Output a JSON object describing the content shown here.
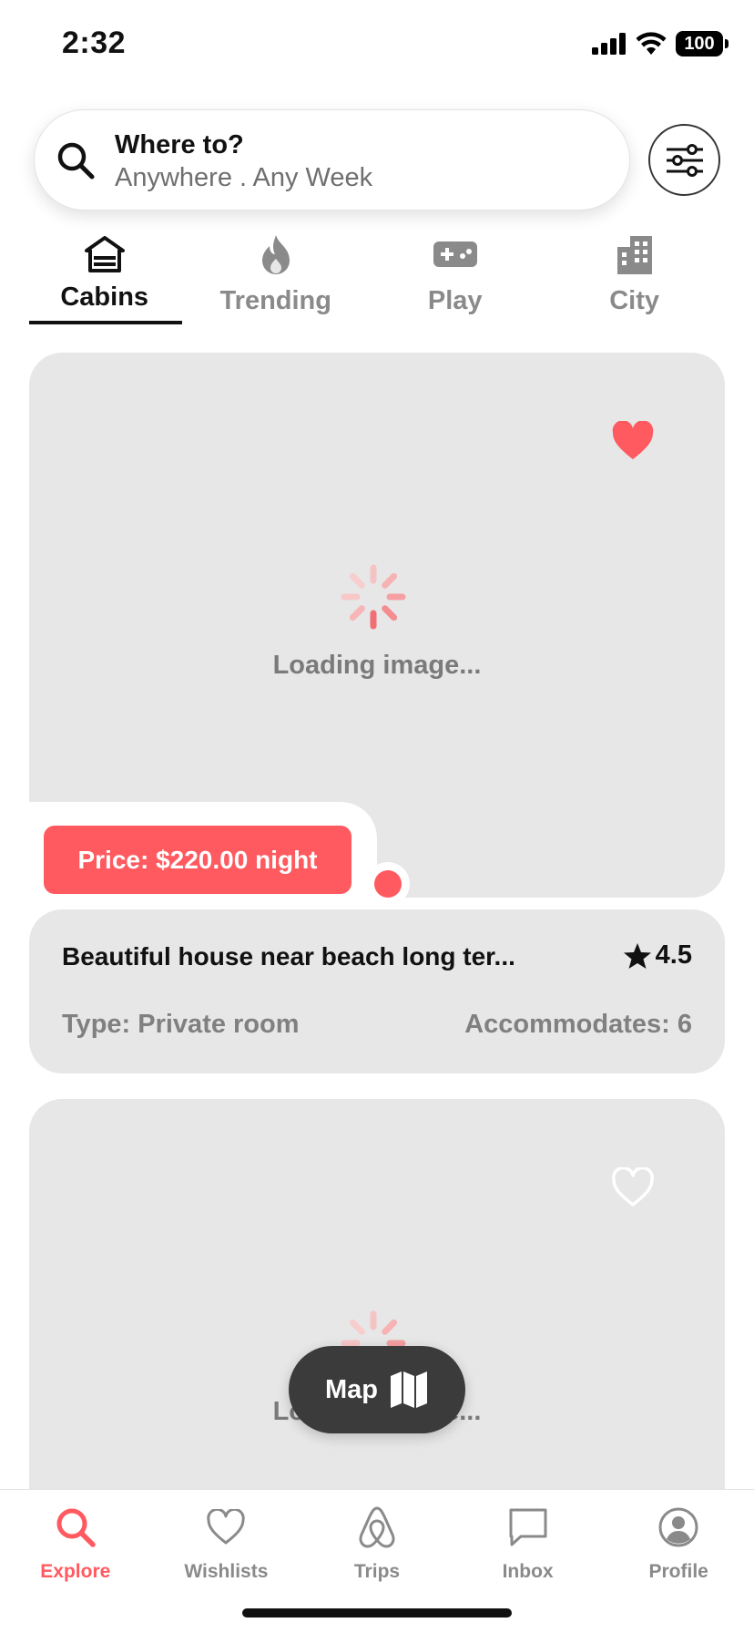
{
  "status_bar": {
    "time": "2:32",
    "battery": "100"
  },
  "search": {
    "title": "Where to?",
    "subtitle": "Anywhere . Any Week"
  },
  "tabs": [
    {
      "label": "Cabins",
      "icon": "cabin-icon",
      "active": true
    },
    {
      "label": "Trending",
      "icon": "fire-icon",
      "active": false
    },
    {
      "label": "Play",
      "icon": "gamepad-icon",
      "active": false
    },
    {
      "label": "City",
      "icon": "building-icon",
      "active": false
    }
  ],
  "listings": [
    {
      "loading_text": "Loading image...",
      "favorited": true,
      "price": "Price: $220.00 night",
      "title": "Beautiful house near beach long ter...",
      "rating": "4.5",
      "type": "Type: Private room",
      "accommodates": "Accommodates: 6"
    },
    {
      "loading_text": "Loading image...",
      "favorited": false
    }
  ],
  "map_button": {
    "label": "Map"
  },
  "bottom_nav": [
    {
      "label": "Explore",
      "icon": "search-icon",
      "active": true
    },
    {
      "label": "Wishlists",
      "icon": "heart-icon",
      "active": false
    },
    {
      "label": "Trips",
      "icon": "airbnb-logo-icon",
      "active": false
    },
    {
      "label": "Inbox",
      "icon": "message-icon",
      "active": false
    },
    {
      "label": "Profile",
      "icon": "user-circle-icon",
      "active": false
    }
  ],
  "colors": {
    "accent": "#ff5a5f",
    "card_bg": "#e7e7e7",
    "muted_text": "#808080",
    "map_button_bg": "#3b3b3b"
  }
}
